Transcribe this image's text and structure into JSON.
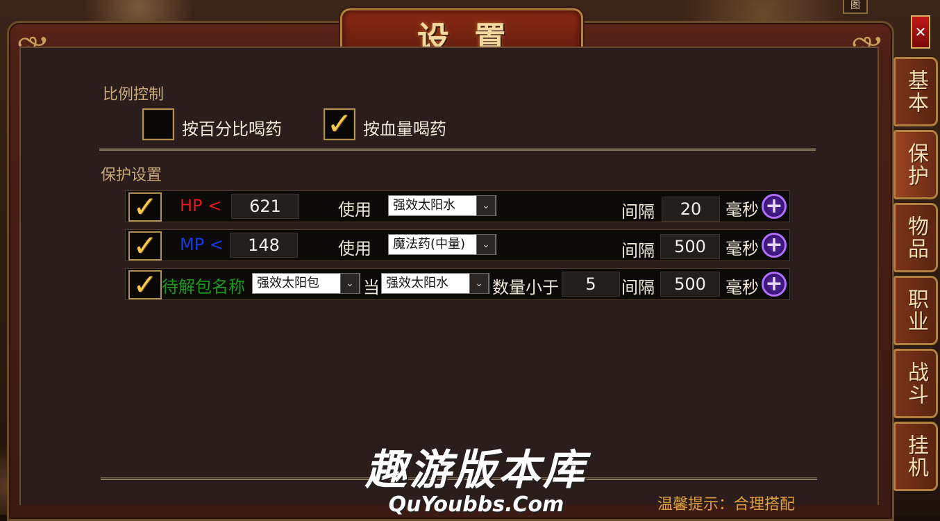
{
  "window": {
    "title": "设置",
    "close_label": "✕",
    "map_label": "图"
  },
  "side_tabs": [
    {
      "label": "基本"
    },
    {
      "label": "保护"
    },
    {
      "label": "物品"
    },
    {
      "label": "职业"
    },
    {
      "label": "战斗"
    },
    {
      "label": "挂机"
    }
  ],
  "ratio_control": {
    "heading": "比例控制",
    "options": [
      {
        "label": "按百分比喝药",
        "checked": false
      },
      {
        "label": "按血量喝药",
        "checked": true
      }
    ]
  },
  "protection": {
    "heading": "保护设置",
    "rows": [
      {
        "checked": true,
        "label": "HP <",
        "label_color": "#e01818",
        "threshold": "621",
        "use_label": "使用",
        "item": "强效太阳水",
        "interval_label": "间隔",
        "interval": "20",
        "unit": "毫秒"
      },
      {
        "checked": true,
        "label": "MP <",
        "label_color": "#1a3ae0",
        "threshold": "148",
        "use_label": "使用",
        "item": "魔法药(中量)",
        "interval_label": "间隔",
        "interval": "500",
        "unit": "毫秒"
      },
      {
        "checked": true,
        "label": "待解包名称",
        "label_color": "#1a9a1a",
        "package": "强效太阳包",
        "when_label": "当",
        "item": "强效太阳水",
        "count_label": "数量小于",
        "count": "5",
        "interval_label": "间隔",
        "interval": "500",
        "unit": "毫秒"
      }
    ]
  },
  "watermark": {
    "line1": "趣游版本库",
    "line2": "QuYoubbs.Com"
  },
  "hint": "温馨提示：合理搭配",
  "check_glyph": "✓",
  "plus_glyph": "+",
  "arrow_glyph": "⌄",
  "colors": {
    "accent_gold": "#b09050",
    "panel_bg": "#2a1d1b",
    "hint": "#e0a040"
  }
}
